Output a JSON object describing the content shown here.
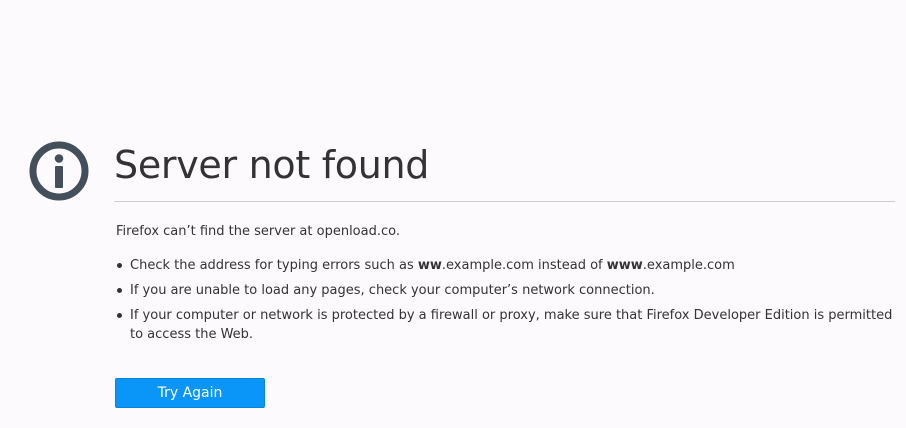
{
  "icon": "info-circle-icon",
  "title": "Server not found",
  "description": "Firefox can’t find the server at openload.co.",
  "bullets": [
    {
      "parts": [
        "Check the address for typing errors such as ",
        "ww",
        ".example.com instead of ",
        "www",
        ".example.com"
      ]
    },
    {
      "text": "If you are unable to load any pages, check your computer’s network connection."
    },
    {
      "text": "If your computer or network is protected by a firewall or proxy, make sure that Firefox Developer Edition is permitted to access the Web."
    }
  ],
  "try_again_label": "Try Again",
  "colors": {
    "background": "#fcfafd",
    "text": "#333333",
    "icon": "#434f5a",
    "button": "#0996f8",
    "divider": "#cccccc"
  }
}
